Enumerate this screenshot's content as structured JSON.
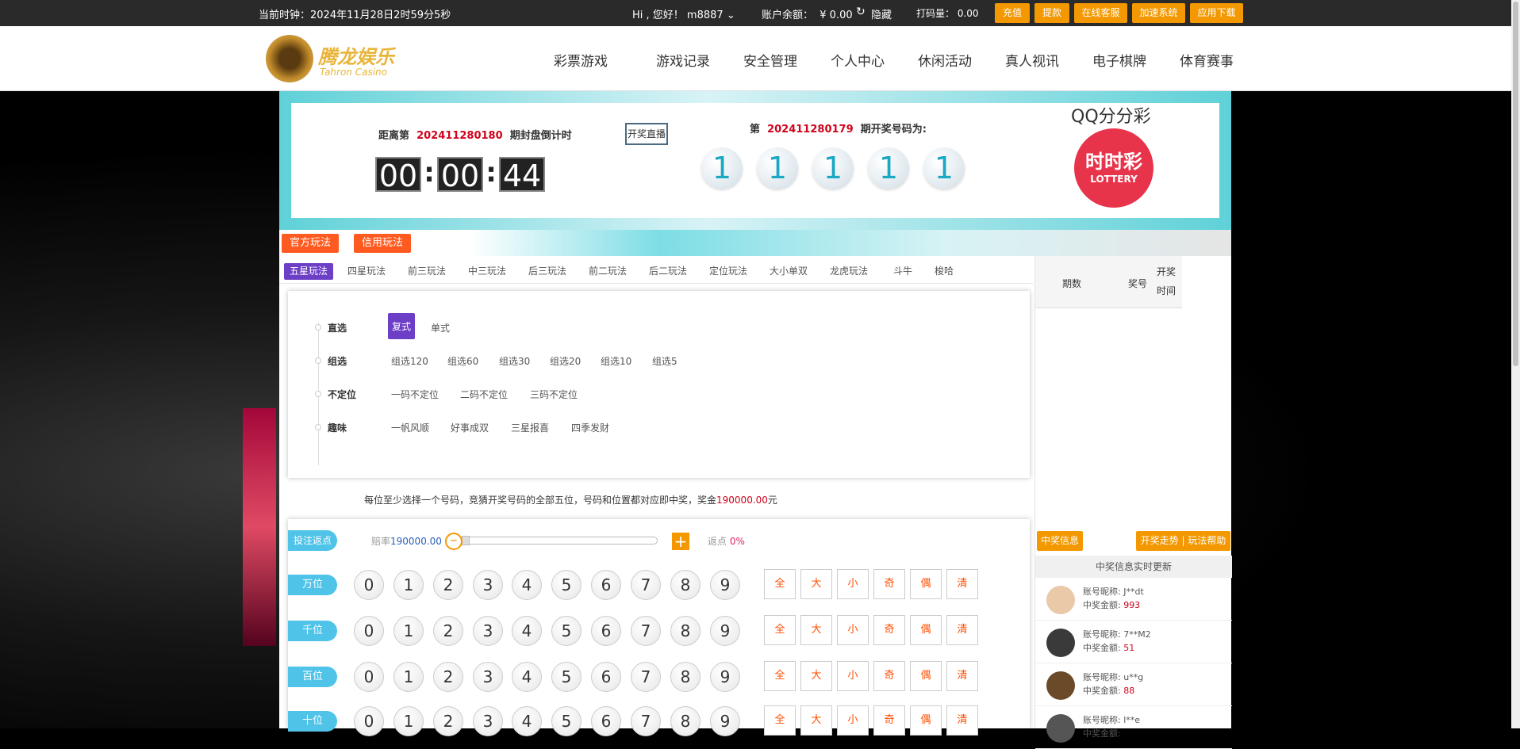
{
  "topbar": {
    "clock": "当前时钟：2024年11月28日2时59分5秒",
    "greeting": "Hi , 您好！ m8887",
    "balance_label": "账户余额：",
    "balance": "¥ 0.00",
    "hide": "隐藏",
    "dama_label": "打码量：",
    "dama": "0.00",
    "buttons": [
      "充值",
      "提款",
      "在线客服",
      "加速系统",
      "应用下载"
    ]
  },
  "header": {
    "logo_cn": "腾龙娱乐",
    "logo_en": "Tahron Casino",
    "nav": [
      "彩票游戏",
      "游戏记录",
      "安全管理",
      "个人中心",
      "休闲活动",
      "真人视讯",
      "电子棋牌",
      "体育赛事"
    ]
  },
  "banner": {
    "countdown_prefix": "距离第",
    "countdown_issue": "202411280180",
    "countdown_suffix": "期封盘倒计时",
    "live_btn": "开奖直播",
    "timer": [
      "00",
      "00",
      "44"
    ],
    "last_prefix": "第",
    "last_issue": "202411280179",
    "last_suffix": "期开奖号码为:",
    "balls": [
      "1",
      "1",
      "1",
      "1",
      "1"
    ],
    "game_name": "QQ分分彩",
    "lottery_logo_cn": "时时彩",
    "lottery_logo_en": "LOTTERY"
  },
  "modes": [
    "官方玩法",
    "信用玩法"
  ],
  "tabs": [
    "五星玩法",
    "四星玩法",
    "前三玩法",
    "中三玩法",
    "后三玩法",
    "前二玩法",
    "后二玩法",
    "定位玩法",
    "大小单双",
    "龙虎玩法",
    "斗牛",
    "梭哈"
  ],
  "play": [
    {
      "label": "直选",
      "options": [
        "复式",
        "单式"
      ]
    },
    {
      "label": "组选",
      "options": [
        "组选120",
        "组选60",
        "组选30",
        "组选20",
        "组选10",
        "组选5"
      ]
    },
    {
      "label": "不定位",
      "options": [
        "一码不定位",
        "二码不定位",
        "三码不定位"
      ]
    },
    {
      "label": "趣味",
      "options": [
        "一帆风顺",
        "好事成双",
        "三星报喜",
        "四季发财"
      ]
    }
  ],
  "desc": {
    "text": "每位至少选择一个号码，竞猜开奖号码的全部五位，号码和位置都对应即中奖，奖金",
    "amount": "190000.00",
    "unit": "元"
  },
  "bet": {
    "rebate_tag": "投注返点",
    "odds_label": "赔率",
    "odds": "190000.00",
    "rebate_label": "返点",
    "rebate": "0%",
    "rows": [
      "万位",
      "千位",
      "百位",
      "十位"
    ],
    "digits": [
      "0",
      "1",
      "2",
      "3",
      "4",
      "5",
      "6",
      "7",
      "8",
      "9"
    ],
    "quick": [
      "全",
      "大",
      "小",
      "奇",
      "偶",
      "清"
    ]
  },
  "side": {
    "col_issue": "期数",
    "col_num": "奖号",
    "col_time": "开奖时间",
    "win_info": "中奖信息",
    "trend": "开奖走势",
    "help": "玩法帮助",
    "live_title": "中奖信息实时更新",
    "name_label": "账号昵称:",
    "amount_label": "中奖金额:",
    "winners": [
      {
        "name": "J**dt",
        "amount": "993"
      },
      {
        "name": "7**M2",
        "amount": "51"
      },
      {
        "name": "u**g",
        "amount": "88"
      },
      {
        "name": "l**e",
        "amount": ""
      }
    ]
  }
}
